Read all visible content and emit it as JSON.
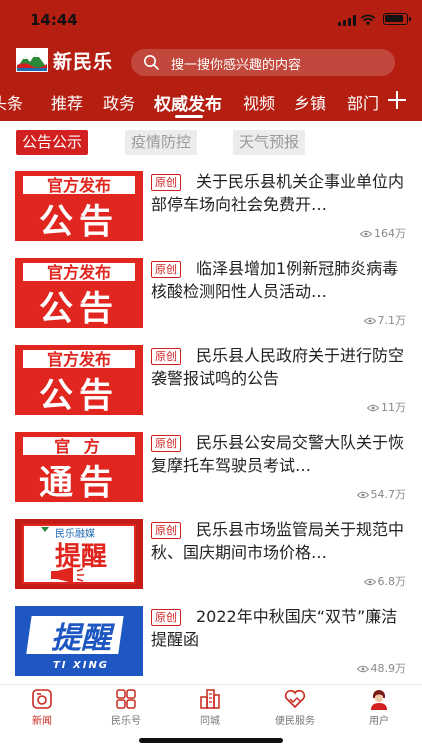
{
  "status": {
    "time": "14:44"
  },
  "header": {
    "app_name": "新民乐",
    "search_placeholder": "搜一搜你感兴趣的内容",
    "logo_icon": "mountain-logo-icon"
  },
  "tabs": [
    {
      "label": "头条"
    },
    {
      "label": "推荐"
    },
    {
      "label": "政务"
    },
    {
      "label": "权威发布",
      "active": true
    },
    {
      "label": "视频"
    },
    {
      "label": "乡镇"
    },
    {
      "label": "部门"
    }
  ],
  "subtabs": [
    {
      "label": "公告公示",
      "active": true
    },
    {
      "label": "疫情防控"
    },
    {
      "label": "天气预报"
    }
  ],
  "articles": [
    {
      "badge": "原创",
      "title": "关于民乐县机关企事业单位内部停车场向社会免费开…",
      "views": "164万",
      "thumb_type": "announcement",
      "thumb_top": "官方发布",
      "thumb_bottom": "公告"
    },
    {
      "badge": "原创",
      "title": "临泽县增加1例新冠肺炎病毒核酸检测阳性人员活动…",
      "views": "7.1万",
      "thumb_type": "announcement",
      "thumb_top": "官方发布",
      "thumb_bottom": "公告"
    },
    {
      "badge": "原创",
      "title": "民乐县人民政府关于进行防空袭警报试鸣的公告",
      "views": "11万",
      "thumb_type": "announcement",
      "thumb_top": "官方发布",
      "thumb_bottom": "公告"
    },
    {
      "badge": "原创",
      "title": "民乐县公安局交警大队关于恢复摩托车驾驶员考试…",
      "views": "54.7万",
      "thumb_type": "notice",
      "thumb_top": "官  方",
      "thumb_bottom": "通告"
    },
    {
      "badge": "原创",
      "title": "民乐县市场监管局关于规范中秋、国庆期间市场价格…",
      "views": "6.8万",
      "thumb_type": "reminder",
      "thumb_top": "民乐融媒",
      "thumb_bottom": "提醒"
    },
    {
      "badge": "原创",
      "title": "2022年中秋国庆“双节”廉洁提醒函",
      "views": "48.9万",
      "thumb_type": "reminder-blue",
      "thumb_top": "提醒",
      "thumb_bottom": "TI XING"
    }
  ],
  "tabbar": [
    {
      "label": "新闻",
      "icon": "news-icon",
      "active": true
    },
    {
      "label": "民乐号",
      "icon": "grid-icon"
    },
    {
      "label": "同城",
      "icon": "city-icon"
    },
    {
      "label": "便民服务",
      "icon": "handshake-heart-icon"
    },
    {
      "label": "用户",
      "icon": "user-avatar-icon"
    }
  ],
  "colors": {
    "brand": "#b51f12",
    "accent": "#d21f1f"
  }
}
